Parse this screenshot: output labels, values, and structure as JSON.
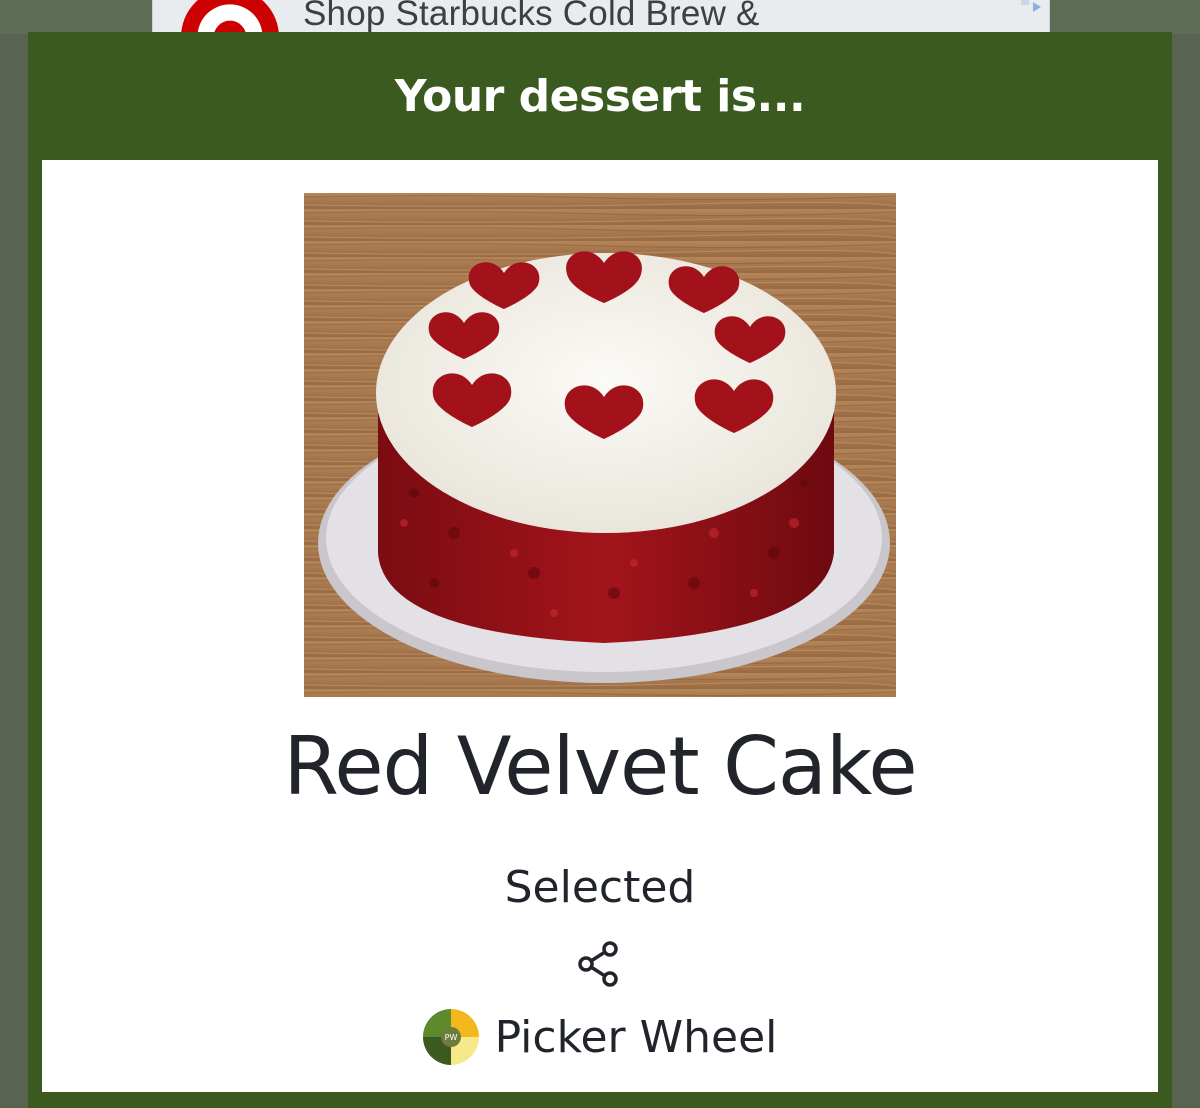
{
  "ad": {
    "text": "Shop Starbucks Cold Brew &",
    "logo_icon": "target-bullseye-logo",
    "choice_icon": "ad-choices-icon"
  },
  "modal": {
    "title": "Your dessert is...",
    "result": "Red Velvet Cake",
    "status": "Selected",
    "share_icon": "share-icon",
    "image_icon": "red-velvet-cake-photo"
  },
  "brand": {
    "name": "Picker Wheel",
    "logo_icon": "picker-wheel-logo",
    "logo_text": "PW"
  },
  "colors": {
    "header_green": "#3a5a20",
    "text_dark": "#21252b",
    "ad_red": "#cc0000"
  }
}
